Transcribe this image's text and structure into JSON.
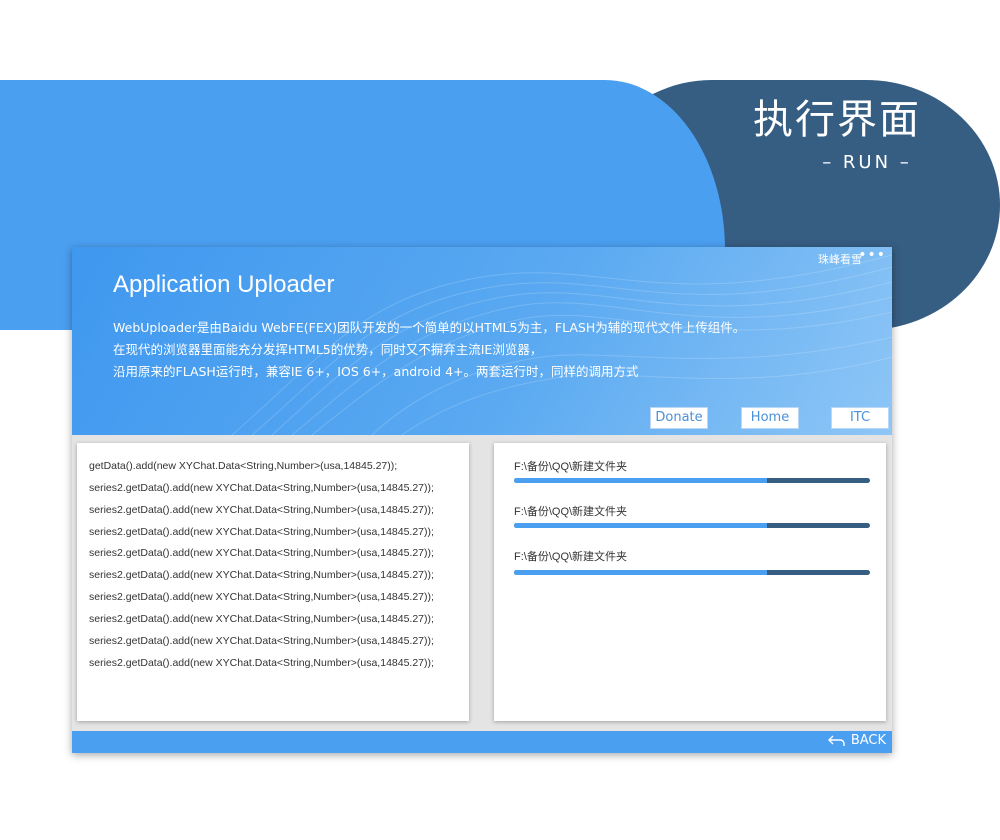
{
  "hero": {
    "title": "执行界面",
    "subtitle": "– RUN –"
  },
  "window": {
    "user": "珠峰看雪",
    "more_icon": "more-dots-icon",
    "title": "Application Uploader",
    "description": [
      "WebUploader是由Baidu WebFE(FEX)团队开发的一个简单的以HTML5为主，FLASH为辅的现代文件上传组件。",
      "在现代的浏览器里面能充分发挥HTML5的优势，同时又不摒弃主流IE浏览器，",
      "沿用原来的FLASH运行时，兼容IE 6+，IOS 6+，android 4+。两套运行时，同样的调用方式"
    ],
    "nav": {
      "donate": "Donate",
      "home": "Home",
      "itc": "ITC"
    },
    "code_lines": [
      "getData().add(new XYChat.Data<String,Number>(usa,14845.27));",
      "series2.getData().add(new XYChat.Data<String,Number>(usa,14845.27));",
      "series2.getData().add(new XYChat.Data<String,Number>(usa,14845.27));",
      "series2.getData().add(new XYChat.Data<String,Number>(usa,14845.27));",
      "series2.getData().add(new XYChat.Data<String,Number>(usa,14845.27));",
      "series2.getData().add(new XYChat.Data<String,Number>(usa,14845.27));",
      "series2.getData().add(new XYChat.Data<String,Number>(usa,14845.27));",
      "series2.getData().add(new XYChat.Data<String,Number>(usa,14845.27));",
      "series2.getData().add(new XYChat.Data<String,Number>(usa,14845.27));",
      "series2.getData().add(new XYChat.Data<String,Number>(usa,14845.27));"
    ],
    "uploads": [
      {
        "path": "F:\\备份\\QQ\\新建文件夹",
        "progress": 0.71
      },
      {
        "path": "F:\\备份\\QQ\\新建文件夹",
        "progress": 0.71
      },
      {
        "path": "F:\\备份\\QQ\\新建文件夹",
        "progress": 0.71
      }
    ],
    "back": {
      "label": "BACK",
      "icon": "back-arrow-icon"
    }
  },
  "colors": {
    "accent": "#4b9ff0",
    "dark": "#365d82",
    "panel_bg": "#e4e4e4"
  }
}
